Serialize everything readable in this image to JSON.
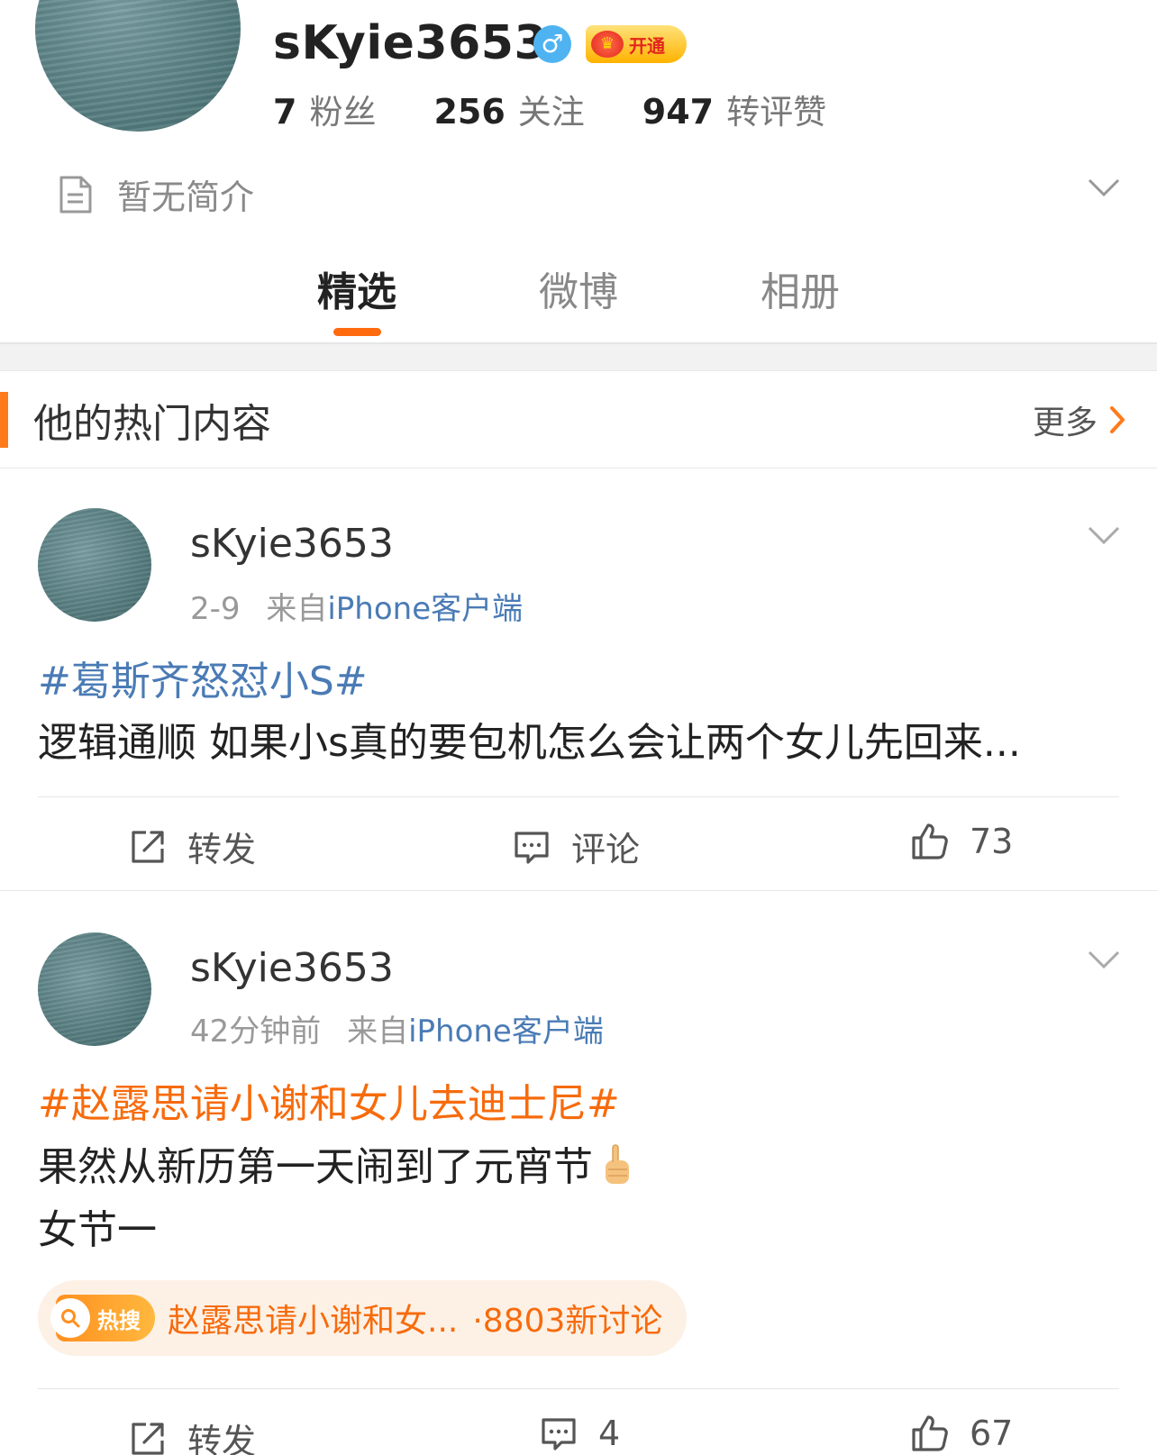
{
  "profile": {
    "username": "sKyie3653",
    "gender_symbol": "♂",
    "vip_label": "开通",
    "stats": [
      {
        "num": "7",
        "label": "粉丝"
      },
      {
        "num": "256",
        "label": "关注"
      },
      {
        "num": "947",
        "label": "转评赞"
      }
    ],
    "bio": "暂无简介"
  },
  "tabs": [
    {
      "label": "精选",
      "active": true
    },
    {
      "label": "微博",
      "active": false
    },
    {
      "label": "相册",
      "active": false
    }
  ],
  "section": {
    "title": "他的热门内容",
    "more_label": "更多"
  },
  "posts": [
    {
      "author": "sKyie3653",
      "time": "2-9",
      "source_prefix": "来自",
      "source": "iPhone客户端",
      "topic": "#葛斯齐怒怼小S#",
      "text_lines": [
        "逻辑通顺 如果小s真的要包机怎么会让两个女儿先回来..."
      ],
      "actions": {
        "repost": "转发",
        "comment": "评论",
        "like": "73"
      }
    },
    {
      "author": "sKyie3653",
      "time": "42分钟前",
      "source_prefix": "来自",
      "source": "iPhone客户端",
      "topic": "#赵露思请小谢和女儿去迪士尼#",
      "text_lines": [
        "果然从新历第一天闹到了元宵节",
        "女节一"
      ],
      "hot": {
        "tag": "热搜",
        "title": "赵露思请小谢和女...",
        "count": "·8803新讨论"
      },
      "actions": {
        "repost": "转发",
        "comment": "4",
        "like": "67"
      }
    }
  ],
  "colors": {
    "accent_orange": "#ff6a0f",
    "link_blue": "#4a7bb5",
    "topic_orange": "#f76b0c"
  }
}
